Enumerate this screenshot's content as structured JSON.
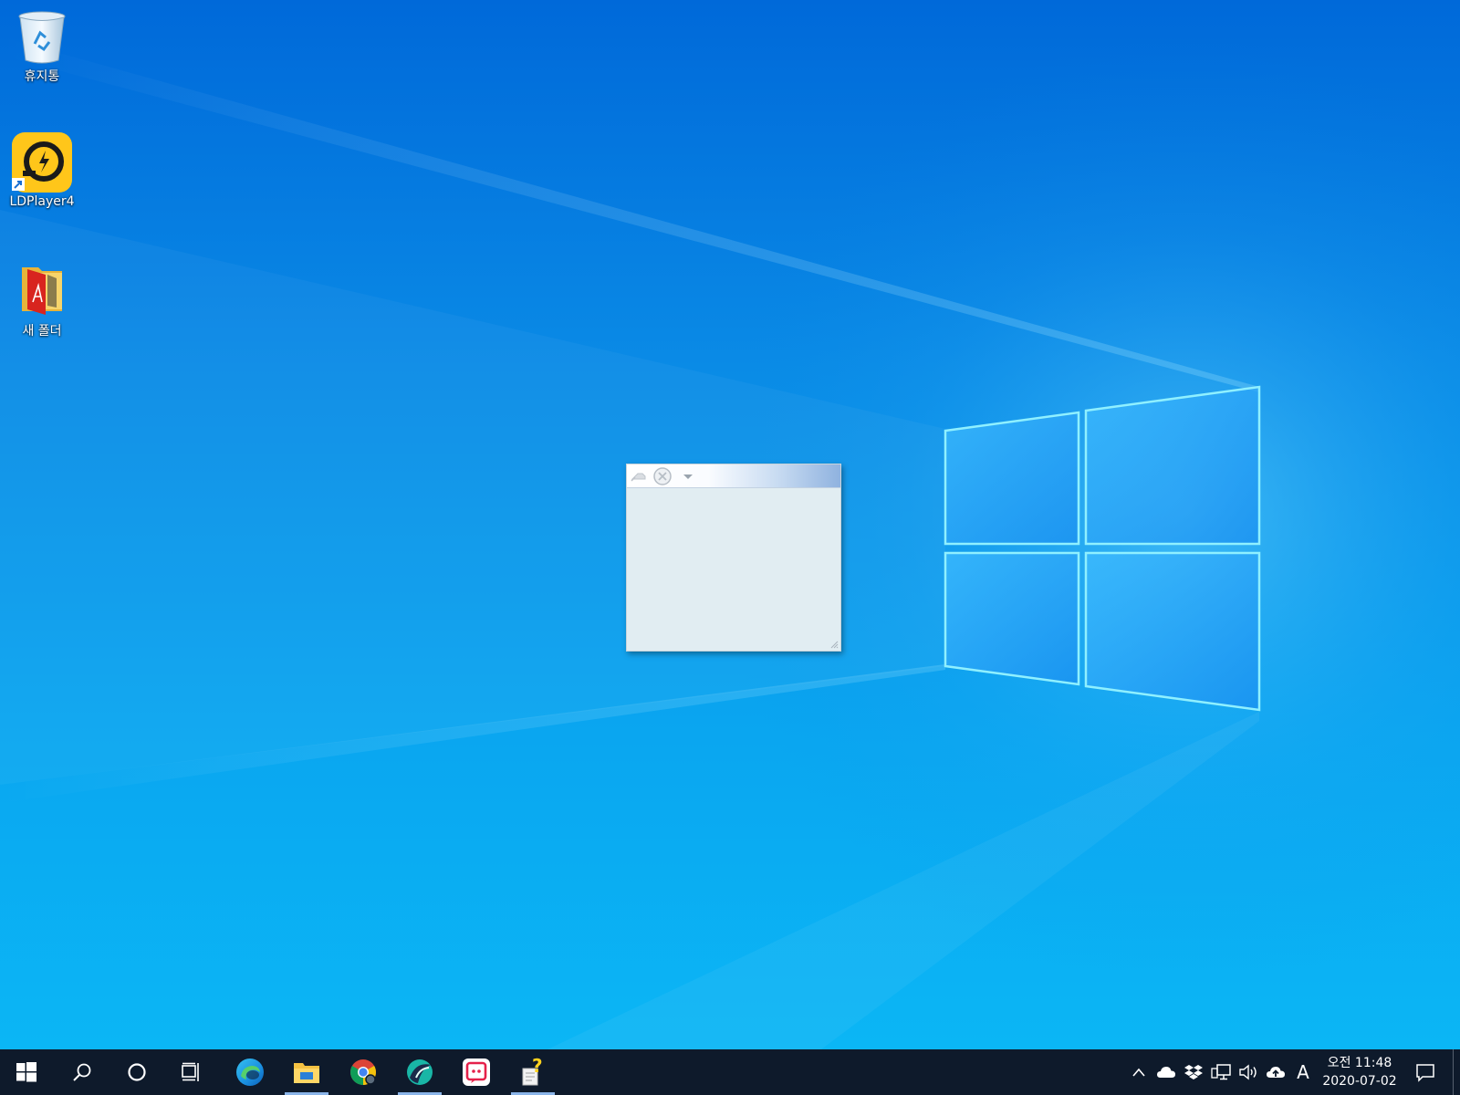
{
  "desktop": {
    "icons": [
      {
        "label": "휴지통",
        "icon": "recycle-bin-icon"
      },
      {
        "label": "LDPlayer4",
        "icon": "ldplayer-icon"
      },
      {
        "label": "새 폴더",
        "icon": "folder-icon"
      }
    ]
  },
  "float_window": {
    "buttons": [
      "pin-icon",
      "close-icon",
      "dropdown-icon"
    ]
  },
  "taskbar": {
    "apps": [
      {
        "name": "start",
        "icon": "windows-start-icon"
      },
      {
        "name": "search",
        "icon": "search-icon"
      },
      {
        "name": "cortana",
        "icon": "cortana-circle-icon"
      },
      {
        "name": "task-view",
        "icon": "task-view-icon"
      },
      {
        "name": "edge",
        "icon": "edge-browser-icon"
      },
      {
        "name": "file-explorer",
        "icon": "file-explorer-icon"
      },
      {
        "name": "chrome",
        "icon": "chrome-icon"
      },
      {
        "name": "app-teal",
        "icon": "teal-app-icon"
      },
      {
        "name": "app-red",
        "icon": "red-app-icon"
      },
      {
        "name": "app-help",
        "icon": "help-note-icon"
      }
    ],
    "tray": {
      "icons": [
        "chevron-up-icon",
        "onedrive-cloud-icon",
        "dropbox-icon",
        "network-icon",
        "volume-icon",
        "cloud-upload-icon"
      ],
      "ime": "A",
      "time": "오전 11:48",
      "date": "2020-07-02"
    }
  },
  "colors": {
    "taskbar": "#0e1a2b",
    "accent_bar": "#8ab4e8",
    "window_body": "#e1edf2"
  }
}
